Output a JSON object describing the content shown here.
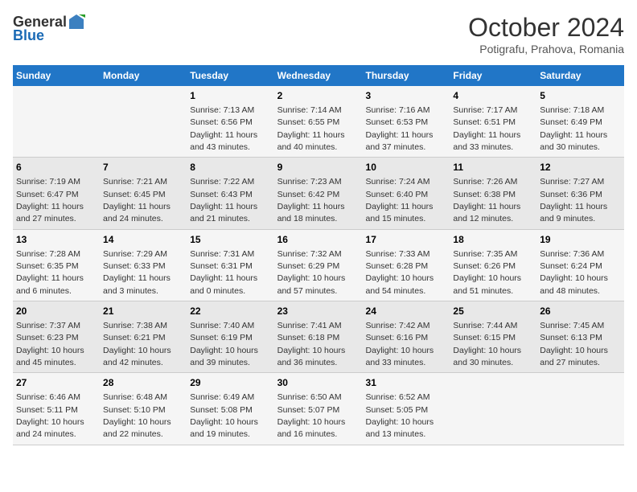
{
  "header": {
    "logo_general": "General",
    "logo_blue": "Blue",
    "month_title": "October 2024",
    "subtitle": "Potigrafu, Prahova, Romania"
  },
  "weekdays": [
    "Sunday",
    "Monday",
    "Tuesday",
    "Wednesday",
    "Thursday",
    "Friday",
    "Saturday"
  ],
  "weeks": [
    [
      {
        "day": "",
        "info": ""
      },
      {
        "day": "",
        "info": ""
      },
      {
        "day": "1",
        "info": "Sunrise: 7:13 AM\nSunset: 6:56 PM\nDaylight: 11 hours and 43 minutes."
      },
      {
        "day": "2",
        "info": "Sunrise: 7:14 AM\nSunset: 6:55 PM\nDaylight: 11 hours and 40 minutes."
      },
      {
        "day": "3",
        "info": "Sunrise: 7:16 AM\nSunset: 6:53 PM\nDaylight: 11 hours and 37 minutes."
      },
      {
        "day": "4",
        "info": "Sunrise: 7:17 AM\nSunset: 6:51 PM\nDaylight: 11 hours and 33 minutes."
      },
      {
        "day": "5",
        "info": "Sunrise: 7:18 AM\nSunset: 6:49 PM\nDaylight: 11 hours and 30 minutes."
      }
    ],
    [
      {
        "day": "6",
        "info": "Sunrise: 7:19 AM\nSunset: 6:47 PM\nDaylight: 11 hours and 27 minutes."
      },
      {
        "day": "7",
        "info": "Sunrise: 7:21 AM\nSunset: 6:45 PM\nDaylight: 11 hours and 24 minutes."
      },
      {
        "day": "8",
        "info": "Sunrise: 7:22 AM\nSunset: 6:43 PM\nDaylight: 11 hours and 21 minutes."
      },
      {
        "day": "9",
        "info": "Sunrise: 7:23 AM\nSunset: 6:42 PM\nDaylight: 11 hours and 18 minutes."
      },
      {
        "day": "10",
        "info": "Sunrise: 7:24 AM\nSunset: 6:40 PM\nDaylight: 11 hours and 15 minutes."
      },
      {
        "day": "11",
        "info": "Sunrise: 7:26 AM\nSunset: 6:38 PM\nDaylight: 11 hours and 12 minutes."
      },
      {
        "day": "12",
        "info": "Sunrise: 7:27 AM\nSunset: 6:36 PM\nDaylight: 11 hours and 9 minutes."
      }
    ],
    [
      {
        "day": "13",
        "info": "Sunrise: 7:28 AM\nSunset: 6:35 PM\nDaylight: 11 hours and 6 minutes."
      },
      {
        "day": "14",
        "info": "Sunrise: 7:29 AM\nSunset: 6:33 PM\nDaylight: 11 hours and 3 minutes."
      },
      {
        "day": "15",
        "info": "Sunrise: 7:31 AM\nSunset: 6:31 PM\nDaylight: 11 hours and 0 minutes."
      },
      {
        "day": "16",
        "info": "Sunrise: 7:32 AM\nSunset: 6:29 PM\nDaylight: 10 hours and 57 minutes."
      },
      {
        "day": "17",
        "info": "Sunrise: 7:33 AM\nSunset: 6:28 PM\nDaylight: 10 hours and 54 minutes."
      },
      {
        "day": "18",
        "info": "Sunrise: 7:35 AM\nSunset: 6:26 PM\nDaylight: 10 hours and 51 minutes."
      },
      {
        "day": "19",
        "info": "Sunrise: 7:36 AM\nSunset: 6:24 PM\nDaylight: 10 hours and 48 minutes."
      }
    ],
    [
      {
        "day": "20",
        "info": "Sunrise: 7:37 AM\nSunset: 6:23 PM\nDaylight: 10 hours and 45 minutes."
      },
      {
        "day": "21",
        "info": "Sunrise: 7:38 AM\nSunset: 6:21 PM\nDaylight: 10 hours and 42 minutes."
      },
      {
        "day": "22",
        "info": "Sunrise: 7:40 AM\nSunset: 6:19 PM\nDaylight: 10 hours and 39 minutes."
      },
      {
        "day": "23",
        "info": "Sunrise: 7:41 AM\nSunset: 6:18 PM\nDaylight: 10 hours and 36 minutes."
      },
      {
        "day": "24",
        "info": "Sunrise: 7:42 AM\nSunset: 6:16 PM\nDaylight: 10 hours and 33 minutes."
      },
      {
        "day": "25",
        "info": "Sunrise: 7:44 AM\nSunset: 6:15 PM\nDaylight: 10 hours and 30 minutes."
      },
      {
        "day": "26",
        "info": "Sunrise: 7:45 AM\nSunset: 6:13 PM\nDaylight: 10 hours and 27 minutes."
      }
    ],
    [
      {
        "day": "27",
        "info": "Sunrise: 6:46 AM\nSunset: 5:11 PM\nDaylight: 10 hours and 24 minutes."
      },
      {
        "day": "28",
        "info": "Sunrise: 6:48 AM\nSunset: 5:10 PM\nDaylight: 10 hours and 22 minutes."
      },
      {
        "day": "29",
        "info": "Sunrise: 6:49 AM\nSunset: 5:08 PM\nDaylight: 10 hours and 19 minutes."
      },
      {
        "day": "30",
        "info": "Sunrise: 6:50 AM\nSunset: 5:07 PM\nDaylight: 10 hours and 16 minutes."
      },
      {
        "day": "31",
        "info": "Sunrise: 6:52 AM\nSunset: 5:05 PM\nDaylight: 10 hours and 13 minutes."
      },
      {
        "day": "",
        "info": ""
      },
      {
        "day": "",
        "info": ""
      }
    ]
  ]
}
